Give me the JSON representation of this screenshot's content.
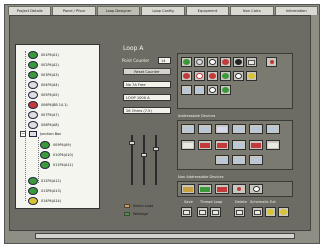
{
  "tabs": [
    {
      "label": "Project Details"
    },
    {
      "label": "Panel / Pfour"
    },
    {
      "label": "Loop Designer"
    },
    {
      "label": "Loop Config"
    },
    {
      "label": "Equipment"
    },
    {
      "label": "Non Calcs"
    },
    {
      "label": "Information"
    }
  ],
  "active_tab_index": 2,
  "loop": {
    "title": "Loop A",
    "point_counter_label": "Point Counter",
    "point_counter_value": "14",
    "reset_counter_label": "Reset Counter",
    "field_mode": "No 7A Free",
    "field_loop": "LOOP 1000 A",
    "field_ohms": "26 Ohms (7.5)"
  },
  "tree": {
    "items": [
      {
        "label": "001P4(A1)",
        "color": "green"
      },
      {
        "label": "002P4(A2)",
        "color": "green"
      },
      {
        "label": "003P4(A3)",
        "color": "green"
      },
      {
        "label": "004P4(A4)",
        "color": "blank"
      },
      {
        "label": "005P4(A5)",
        "color": "blank"
      },
      {
        "label": "006P4(BB 14.1)",
        "color": "red"
      },
      {
        "label": "007P4(A7)",
        "color": "blank"
      },
      {
        "label": "008P4(A8)",
        "color": "blank"
      },
      {
        "label": "Junction Box",
        "color": "blank"
      },
      {
        "label": "009P4(A9)",
        "color": "green"
      },
      {
        "label": "010P4(A10)",
        "color": "green"
      },
      {
        "label": "011P4(A11)",
        "color": "green"
      },
      {
        "label": "012P4(A12)",
        "color": "green"
      },
      {
        "label": "013P4(A13)",
        "color": "green"
      },
      {
        "label": "014P4(A14)",
        "color": "yellow"
      }
    ]
  },
  "legend": {
    "items": [
      {
        "label": "Alarm Load",
        "color": "#e89a3a"
      },
      {
        "label": "Wattage",
        "color": "#3a9a3a"
      }
    ]
  },
  "groups": {
    "addressable_devices": "Addressable Devices",
    "non_addressable_devices": "Non Addressable Devices"
  },
  "actions": {
    "save": "Save",
    "thread_loop": "Thread Loop",
    "delete": "Delete",
    "schematic_ext": "Schematic Ext"
  },
  "colors": {
    "window_bg": "#8e8e84",
    "panel_bg": "#6c6c64",
    "tree_bg": "#f5f5f0",
    "accent_red": "#c23a3a",
    "accent_green": "#3a9a3a"
  }
}
